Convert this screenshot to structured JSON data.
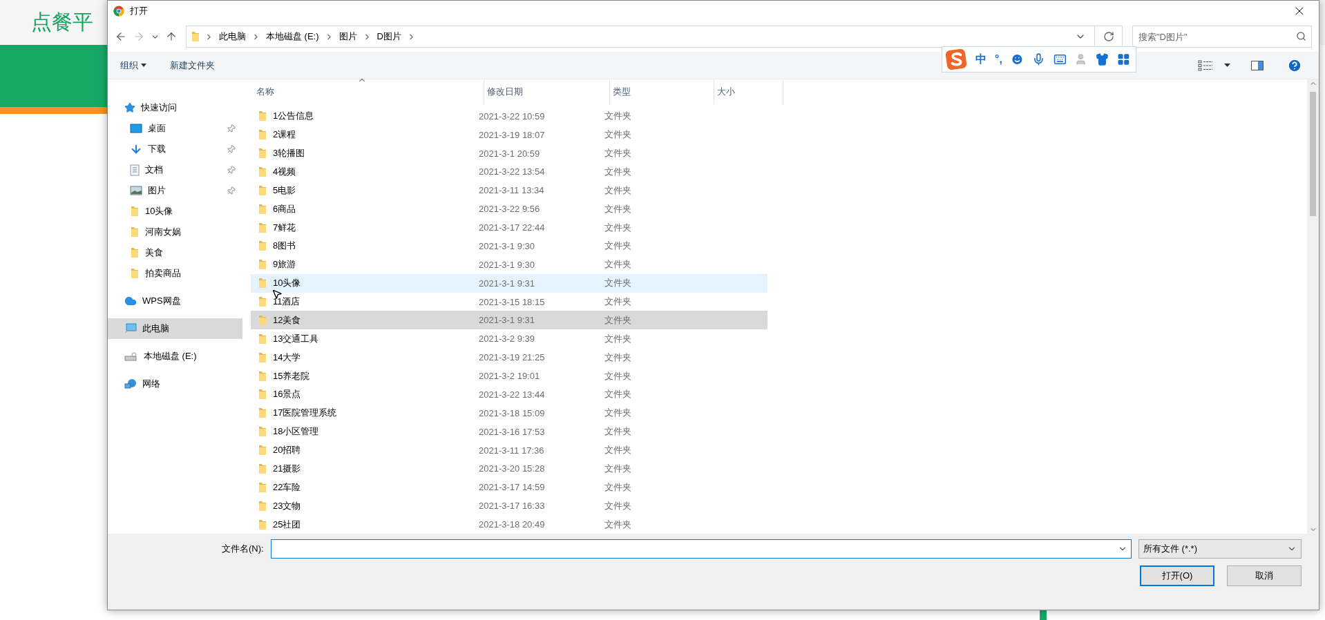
{
  "background_page": {
    "title": "点餐平"
  },
  "dialog": {
    "title": "打开",
    "breadcrumb": [
      "此电脑",
      "本地磁盘 (E:)",
      "图片",
      "D图片"
    ],
    "search": {
      "placeholder": "搜索\"D图片\""
    },
    "toolbar": {
      "organize": "组织",
      "new_folder": "新建文件夹"
    },
    "ime": {
      "mode": "中",
      "punctuation": "°,"
    },
    "sidebar": [
      {
        "label": "快速访问",
        "kind": "star",
        "selected": false,
        "children": [
          {
            "label": "桌面",
            "kind": "desktop",
            "pinned": true,
            "selected": false
          },
          {
            "label": "下载",
            "kind": "download",
            "pinned": true,
            "selected": false
          },
          {
            "label": "文档",
            "kind": "document",
            "pinned": true,
            "selected": false
          },
          {
            "label": "图片",
            "kind": "pictures",
            "pinned": true,
            "selected": false
          },
          {
            "label": "10头像",
            "kind": "folder",
            "pinned": false,
            "selected": false
          },
          {
            "label": "河南女娲",
            "kind": "folder",
            "pinned": false,
            "selected": false
          },
          {
            "label": "美食",
            "kind": "folder",
            "pinned": false,
            "selected": false
          },
          {
            "label": "拍卖商品",
            "kind": "folder",
            "pinned": false,
            "selected": false
          }
        ]
      },
      {
        "label": "WPS网盘",
        "kind": "cloud",
        "selected": false
      },
      {
        "label": "此电脑",
        "kind": "computer",
        "selected": true
      },
      {
        "label": "本地磁盘 (E:)",
        "kind": "drive",
        "selected": false
      },
      {
        "label": "网络",
        "kind": "network",
        "selected": false
      }
    ],
    "columns": [
      {
        "label": "名称",
        "sorted": true
      },
      {
        "label": "修改日期",
        "sorted": false
      },
      {
        "label": "类型",
        "sorted": false
      },
      {
        "label": "大小",
        "sorted": false
      }
    ],
    "rows": [
      {
        "name": "1公告信息",
        "date": "2021-3-22 10:59",
        "type": "文件夹",
        "hovered": false,
        "selected": false
      },
      {
        "name": "2课程",
        "date": "2021-3-19 18:07",
        "type": "文件夹",
        "hovered": false,
        "selected": false
      },
      {
        "name": "3轮播图",
        "date": "2021-3-1 20:59",
        "type": "文件夹",
        "hovered": false,
        "selected": false
      },
      {
        "name": "4视频",
        "date": "2021-3-22 13:54",
        "type": "文件夹",
        "hovered": false,
        "selected": false
      },
      {
        "name": "5电影",
        "date": "2021-3-11 13:34",
        "type": "文件夹",
        "hovered": false,
        "selected": false
      },
      {
        "name": "6商品",
        "date": "2021-3-22 9:56",
        "type": "文件夹",
        "hovered": false,
        "selected": false
      },
      {
        "name": "7鲜花",
        "date": "2021-3-17 22:44",
        "type": "文件夹",
        "hovered": false,
        "selected": false
      },
      {
        "name": "8图书",
        "date": "2021-3-1 9:30",
        "type": "文件夹",
        "hovered": false,
        "selected": false
      },
      {
        "name": "9旅游",
        "date": "2021-3-1 9:30",
        "type": "文件夹",
        "hovered": false,
        "selected": false
      },
      {
        "name": "10头像",
        "date": "2021-3-1 9:31",
        "type": "文件夹",
        "hovered": true,
        "selected": false
      },
      {
        "name": "11酒店",
        "date": "2021-3-15 18:15",
        "type": "文件夹",
        "hovered": false,
        "selected": false
      },
      {
        "name": "12美食",
        "date": "2021-3-1 9:31",
        "type": "文件夹",
        "hovered": false,
        "selected": true
      },
      {
        "name": "13交通工具",
        "date": "2021-3-2 9:39",
        "type": "文件夹",
        "hovered": false,
        "selected": false
      },
      {
        "name": "14大学",
        "date": "2021-3-19 21:25",
        "type": "文件夹",
        "hovered": false,
        "selected": false
      },
      {
        "name": "15养老院",
        "date": "2021-3-2 19:01",
        "type": "文件夹",
        "hovered": false,
        "selected": false
      },
      {
        "name": "16景点",
        "date": "2021-3-22 13:44",
        "type": "文件夹",
        "hovered": false,
        "selected": false
      },
      {
        "name": "17医院管理系统",
        "date": "2021-3-18 15:09",
        "type": "文件夹",
        "hovered": false,
        "selected": false
      },
      {
        "name": "18小区管理",
        "date": "2021-3-16 17:53",
        "type": "文件夹",
        "hovered": false,
        "selected": false
      },
      {
        "name": "20招聘",
        "date": "2021-3-11 17:36",
        "type": "文件夹",
        "hovered": false,
        "selected": false
      },
      {
        "name": "21摄影",
        "date": "2021-3-20 15:28",
        "type": "文件夹",
        "hovered": false,
        "selected": false
      },
      {
        "name": "22车险",
        "date": "2021-3-17 14:59",
        "type": "文件夹",
        "hovered": false,
        "selected": false
      },
      {
        "name": "23文物",
        "date": "2021-3-17 16:33",
        "type": "文件夹",
        "hovered": false,
        "selected": false
      },
      {
        "name": "25社团",
        "date": "2021-3-18 20:49",
        "type": "文件夹",
        "hovered": false,
        "selected": false
      }
    ],
    "footer": {
      "filename_label": "文件名(N):",
      "file_type": "所有文件 (*.*)",
      "buttons": [
        {
          "label": "打开(O)",
          "default": true
        },
        {
          "label": "取消",
          "default": false
        }
      ]
    }
  }
}
